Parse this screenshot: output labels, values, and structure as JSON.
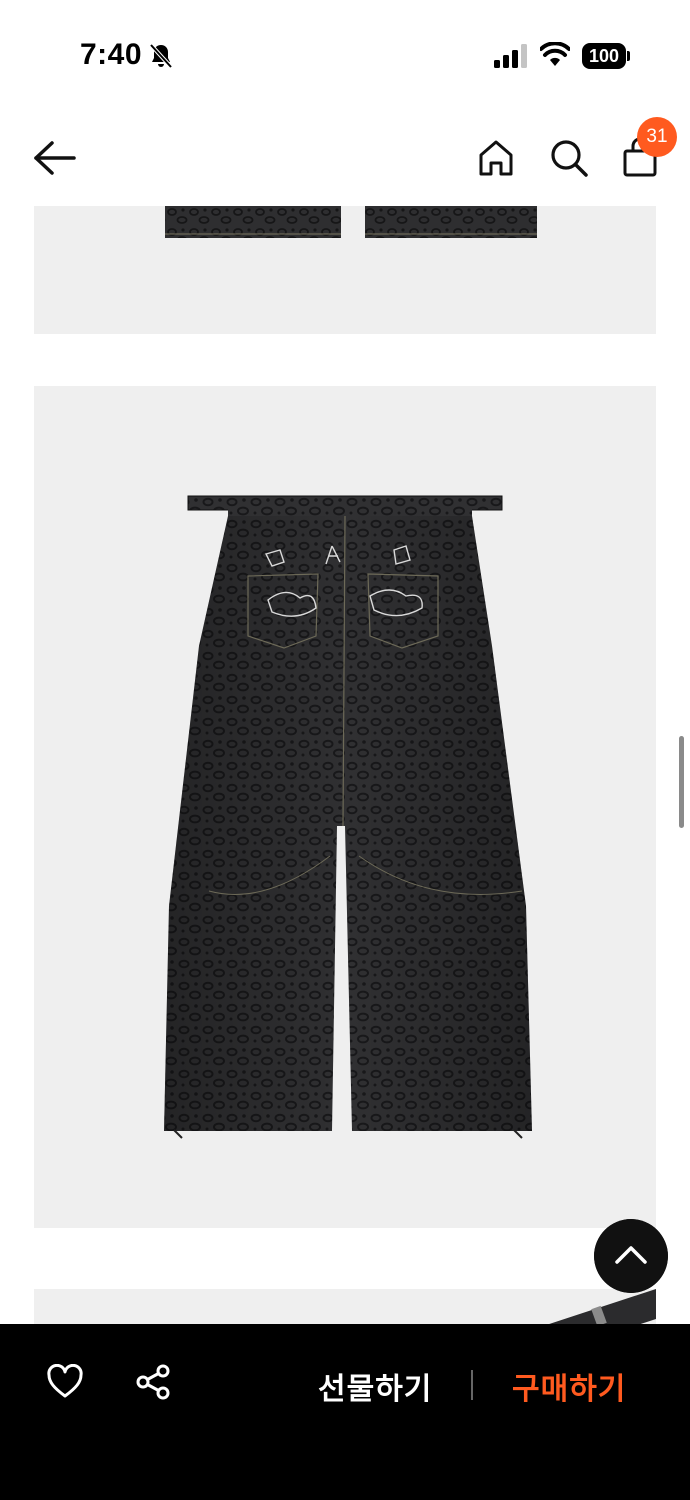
{
  "status_bar": {
    "time": "7:40",
    "battery": "100",
    "icons": [
      "bell-off-icon",
      "signal-icon",
      "wifi-icon",
      "battery-icon"
    ]
  },
  "nav": {
    "icons": [
      "back-arrow-icon",
      "home-icon",
      "search-icon",
      "shopping-bag-icon"
    ],
    "cart_count": "31"
  },
  "product_images": [
    {
      "name": "pants-front-image-bottom"
    },
    {
      "name": "pants-back-image"
    },
    {
      "name": "belt-detail-image"
    }
  ],
  "bottom_bar": {
    "gift_label": "선물하기",
    "buy_label": "구매하기",
    "icons": [
      "heart-icon",
      "share-icon"
    ]
  },
  "colors": {
    "accent": "#ff5a1f",
    "bar_bg": "#000000",
    "panel_bg": "#efefef"
  }
}
